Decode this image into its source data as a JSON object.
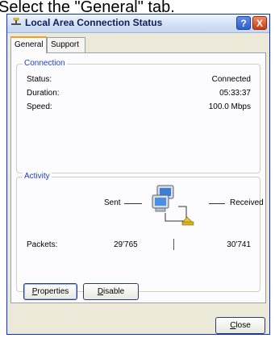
{
  "caption": {
    "text": "Select the \"General\" tab."
  },
  "window": {
    "title": "Local Area Connection Status",
    "help_label": "?",
    "close_label": "X"
  },
  "tabs": [
    {
      "label": "General",
      "active": true
    },
    {
      "label": "Support",
      "active": false
    }
  ],
  "connection": {
    "title": "Connection",
    "rows": [
      {
        "label": "Status:",
        "value": "Connected"
      },
      {
        "label": "Duration:",
        "value": "05:33:37"
      },
      {
        "label": "Speed:",
        "value": "100.0 Mbps"
      }
    ]
  },
  "activity": {
    "title": "Activity",
    "sent_label": "Sent",
    "received_label": "Received",
    "packets_label": "Packets:",
    "sent_value": "29'765",
    "received_value": "30'741",
    "separator": "|"
  },
  "buttons": {
    "properties_first": "P",
    "properties_rest": "roperties",
    "disable_first": "D",
    "disable_rest": "isable",
    "close_first": "C",
    "close_rest": "lose"
  },
  "colors": {
    "window_bg": "#ece9d8",
    "group_title": "#1f3fbf",
    "tab_active_accent": "#f0a020"
  }
}
